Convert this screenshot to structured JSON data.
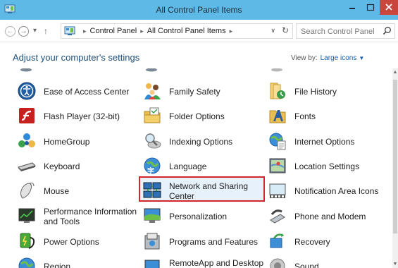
{
  "window": {
    "title": "All Control Panel Items",
    "colors": {
      "titlebar": "#5fb9e6",
      "close": "#c9463d",
      "selection_border": "#d2262a",
      "link": "#1b5ea8"
    }
  },
  "nav": {
    "back": "←",
    "forward": "→",
    "recent": "▾",
    "up": "↑"
  },
  "address": {
    "crumbs": [
      "Control Panel",
      "All Control Panel Items"
    ],
    "separator": "▸"
  },
  "search": {
    "placeholder": "Search Control Panel"
  },
  "header": {
    "heading": "Adjust your computer's settings",
    "view_by_label": "View by:",
    "view_by_value": "Large icons"
  },
  "items": [
    {
      "label": "Ease of Access Center",
      "icon": "ease-of-access-icon"
    },
    {
      "label": "Family Safety",
      "icon": "family-safety-icon"
    },
    {
      "label": "File History",
      "icon": "file-history-icon"
    },
    {
      "label": "Flash Player (32-bit)",
      "icon": "flash-player-icon"
    },
    {
      "label": "Folder Options",
      "icon": "folder-options-icon"
    },
    {
      "label": "Fonts",
      "icon": "fonts-icon"
    },
    {
      "label": "HomeGroup",
      "icon": "homegroup-icon"
    },
    {
      "label": "Indexing Options",
      "icon": "indexing-options-icon"
    },
    {
      "label": "Internet Options",
      "icon": "internet-options-icon"
    },
    {
      "label": "Keyboard",
      "icon": "keyboard-icon"
    },
    {
      "label": "Language",
      "icon": "language-icon"
    },
    {
      "label": "Location Settings",
      "icon": "location-settings-icon"
    },
    {
      "label": "Mouse",
      "icon": "mouse-icon"
    },
    {
      "label": "Network and Sharing Center",
      "icon": "network-sharing-icon",
      "selected": true
    },
    {
      "label": "Notification Area Icons",
      "icon": "notification-area-icon"
    },
    {
      "label": "Performance Information and Tools",
      "icon": "performance-icon"
    },
    {
      "label": "Personalization",
      "icon": "personalization-icon"
    },
    {
      "label": "Phone and Modem",
      "icon": "phone-modem-icon"
    },
    {
      "label": "Power Options",
      "icon": "power-options-icon"
    },
    {
      "label": "Programs and Features",
      "icon": "programs-features-icon"
    },
    {
      "label": "Recovery",
      "icon": "recovery-icon"
    },
    {
      "label": "Region",
      "icon": "region-icon"
    },
    {
      "label": "RemoteApp and Desktop",
      "icon": "remoteapp-icon"
    },
    {
      "label": "Sound",
      "icon": "sound-icon"
    }
  ]
}
